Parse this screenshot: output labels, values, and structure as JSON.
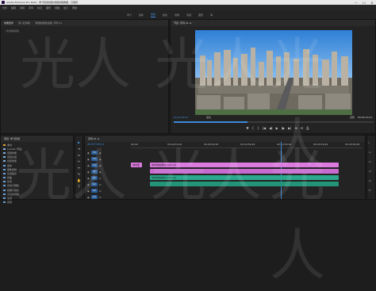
{
  "titlebar": {
    "title": "Adobe Premiere Pro 2020 - 学习影视剪辑/视频剪辑教程 - 已保存",
    "min": "—",
    "max": "☐",
    "close": "✕"
  },
  "menu": [
    "文件",
    "编辑",
    "剪辑",
    "序列",
    "标记",
    "图形",
    "视图",
    "窗口",
    "帮助"
  ],
  "workspaces": [
    {
      "label": "学习",
      "active": false
    },
    {
      "label": "组件",
      "active": false
    },
    {
      "label": "编辑",
      "active": true
    },
    {
      "label": "颜色",
      "active": false
    },
    {
      "label": "效果",
      "active": false
    },
    {
      "label": "音频",
      "active": false
    },
    {
      "label": "图形",
      "active": false
    },
    {
      "label": "库",
      "active": false
    }
  ],
  "source": {
    "tabs": [
      "效果控件",
      "源:(无剪辑)",
      "音频剪辑混合器: 序列 01"
    ],
    "empty": "(未选择剪辑)"
  },
  "program": {
    "tab": "节目: 序列 01 ≡",
    "timecode": "00;07;26;11",
    "fit": "适合",
    "full": "完整",
    "duration": "00;05;14;01",
    "progress": 0.37,
    "controls": [
      "▼",
      "{",
      "}",
      "|◀",
      "◀|",
      "▶",
      "|▶",
      "▶|",
      "⊞",
      "⊟",
      "⎙"
    ]
  },
  "project": {
    "tab": "项目: 学习影视",
    "items": [
      {
        "label": "素材",
        "color": "#e6a33a"
      },
      {
        "label": "Lumetri 预设",
        "color": "#7fb0e0"
      },
      {
        "label": "音频效果",
        "color": "#7fb0e0"
      },
      {
        "label": "音频过渡",
        "color": "#7fb0e0"
      },
      {
        "label": "视频效果",
        "color": "#7fb0e0"
      },
      {
        "label": "变换",
        "color": "#6aa0d8"
      },
      {
        "label": "图像控制",
        "color": "#6aa0d8"
      },
      {
        "label": "实用程序",
        "color": "#6aa0d8"
      },
      {
        "label": "扭曲",
        "color": "#6aa0d8"
      },
      {
        "label": "时间",
        "color": "#6aa0d8"
      },
      {
        "label": "杂色与颗粒",
        "color": "#6aa0d8"
      },
      {
        "label": "模糊与锐化",
        "color": "#6aa0d8"
      },
      {
        "label": "沉浸式视频",
        "color": "#6aa0d8"
      },
      {
        "label": "生成",
        "color": "#6aa0d8"
      },
      {
        "label": "视频",
        "color": "#6aa0d8"
      }
    ]
  },
  "tools": [
    "▶",
    "⇥",
    "⇔",
    "✂",
    "↔",
    "✎",
    "✋",
    "T"
  ],
  "timeline": {
    "tab": "序列 01 ≡",
    "timecode": "00;07;26;11",
    "ruler": [
      "00;00",
      "00;04;59;16",
      "00;09;59;29",
      "00;14;59;29",
      "00;19;59;29",
      "00;24;59;29",
      "00;29;59;28"
    ],
    "tracks": [
      "V4",
      "V3",
      "V2",
      "V1",
      "A1",
      "A2",
      "A3",
      "A4"
    ],
    "clips": {
      "v_left": "城市夜景.mp4",
      "v_main": "城市航拍素材.mp4 [V]",
      "a_main": "城市航拍素材.mp4 [A]"
    }
  },
  "meters": [
    "0",
    "-12",
    "-24",
    "-36",
    "-48",
    "dB"
  ],
  "watermark": "光人",
  "colors": {
    "accent": "#3b8ad9",
    "video_clip": "#dc7ae0",
    "audio_clip": "#2ca88d"
  }
}
